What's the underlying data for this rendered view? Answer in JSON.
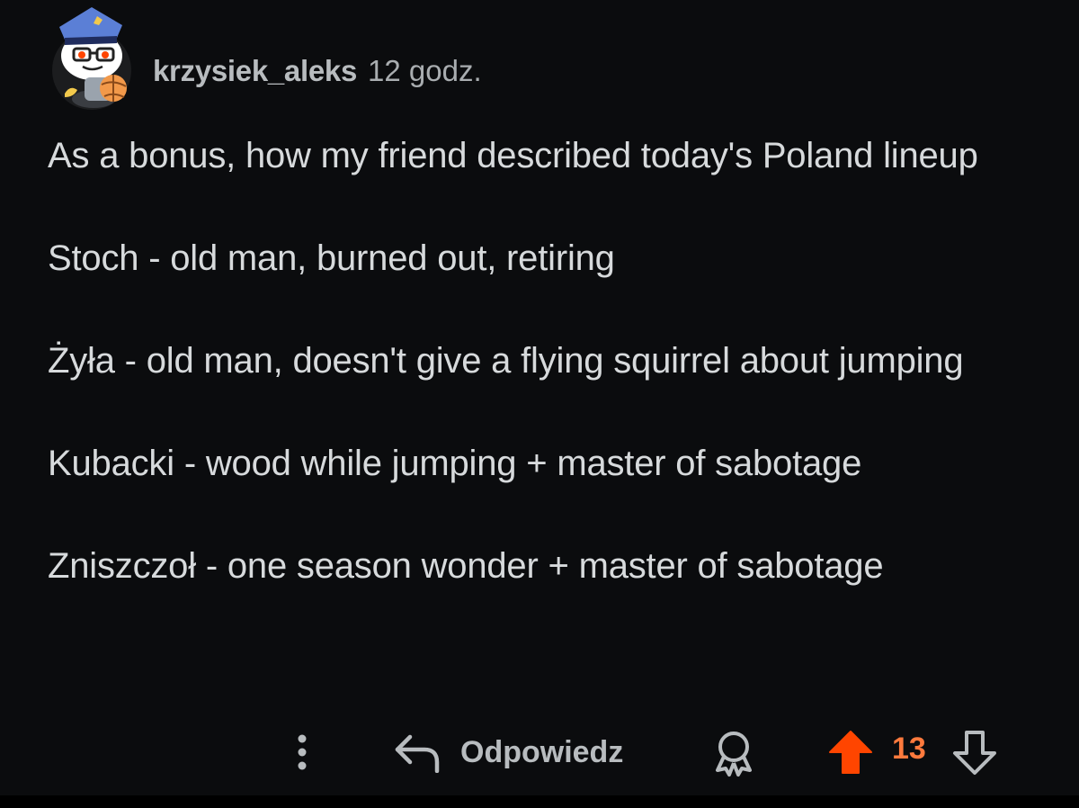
{
  "comment": {
    "author": "krzysiek_aleks",
    "timestamp": "12 godz.",
    "paragraphs": [
      "As a bonus, how my friend described today's Poland lineup",
      "Stoch - old man, burned out, retiring",
      "Żyła - old man, doesn't give a flying squirrel about jumping",
      "Kubacki - wood while jumping + master of sabotage",
      "Zniszczoł - one season wonder + master of sabotage"
    ]
  },
  "actions": {
    "more_icon": "vertical-dots-icon",
    "reply_icon": "reply-arrow-icon",
    "reply_label": "Odpowiedz",
    "award_icon": "award-icon",
    "upvote_icon": "upvote-arrow-icon",
    "score": "13",
    "downvote_icon": "downvote-arrow-icon"
  },
  "colors": {
    "background": "#0b0c0e",
    "text": "#d7dadc",
    "muted": "#b8bcbf",
    "upvote_accent": "#ff4500",
    "score_accent": "#ff7a3d"
  }
}
